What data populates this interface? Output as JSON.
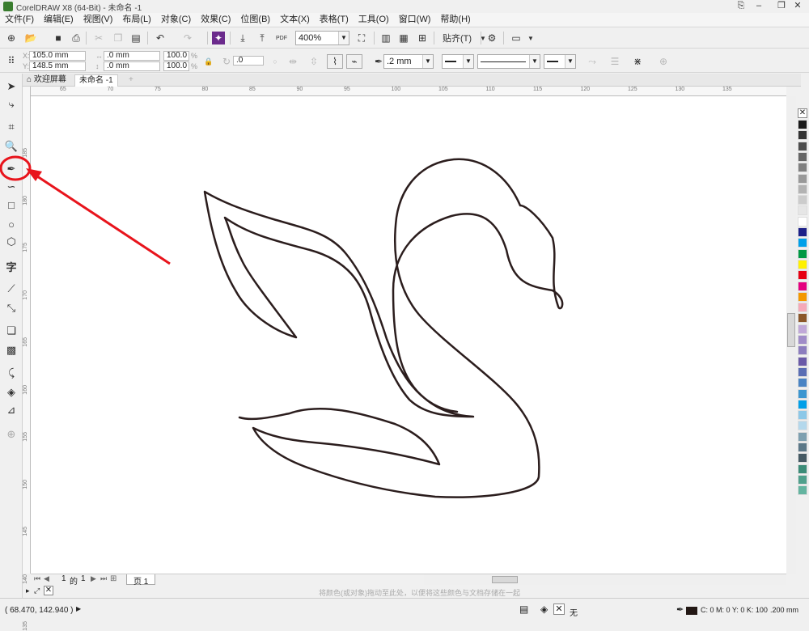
{
  "window": {
    "title": "CorelDRAW X8 (64-Bit) - 未命名 -1"
  },
  "menu": [
    "文件(F)",
    "编辑(E)",
    "视图(V)",
    "布局(L)",
    "对象(C)",
    "效果(C)",
    "位图(B)",
    "文本(X)",
    "表格(T)",
    "工具(O)",
    "窗口(W)",
    "帮助(H)"
  ],
  "standard_toolbar": {
    "pdf_label": "PDF",
    "zoom": "400%",
    "snap_label": "贴齐(T)"
  },
  "property_bar": {
    "x": "105.0 mm",
    "y": "148.5 mm",
    "width": ".0 mm",
    "height": ".0 mm",
    "scale_w": "100.0",
    "scale_h": "100.0",
    "percent": "%",
    "angle": ".0",
    "outline_width": ".2 mm"
  },
  "tabs": {
    "welcome": "欢迎屏幕",
    "document": "未命名 -1"
  },
  "ruler": {
    "h": [
      "65",
      "70",
      "75",
      "80",
      "85",
      "90",
      "95",
      "100",
      "105",
      "110",
      "115",
      "120",
      "125",
      "130",
      "135"
    ],
    "v": [
      "185",
      "180",
      "175",
      "170",
      "165",
      "160",
      "155",
      "150",
      "145",
      "140",
      "135"
    ]
  },
  "page_nav": {
    "current": "1",
    "of": "的",
    "total": "1",
    "page_tab": "页 1"
  },
  "hint": "将颜色(或对象)拖动至此处，以便将这些颜色与文档存储在一起",
  "status": {
    "coords": "( 68.470, 142.940 )",
    "fill": "无",
    "outline_color": "C: 0 M: 0 Y: 0 K: 100",
    "outline_width": ".200 mm"
  },
  "palette": [
    "#1a1a1a",
    "#333333",
    "#4d4d4d",
    "#666666",
    "#808080",
    "#999999",
    "#b3b3b3",
    "#cccccc",
    "#e6e6e6",
    "#ffffff",
    "#1d2088",
    "#00a0e9",
    "#009944",
    "#fff100",
    "#e60012",
    "#e4007f",
    "#f39800",
    "#f5a9b8",
    "#8b572a",
    "#c0a8d8",
    "#a08cc8",
    "#8c7dbe",
    "#6a5aa8",
    "#5a6eb4",
    "#4a84c4",
    "#3c96d0",
    "#009fe8",
    "#8cc8e8",
    "#b4d8ec",
    "#7ea0b0",
    "#5c7888",
    "#465a64",
    "#3c8c78",
    "#50a08c",
    "#64b4a0"
  ],
  "annotation_color": "#e8141c"
}
